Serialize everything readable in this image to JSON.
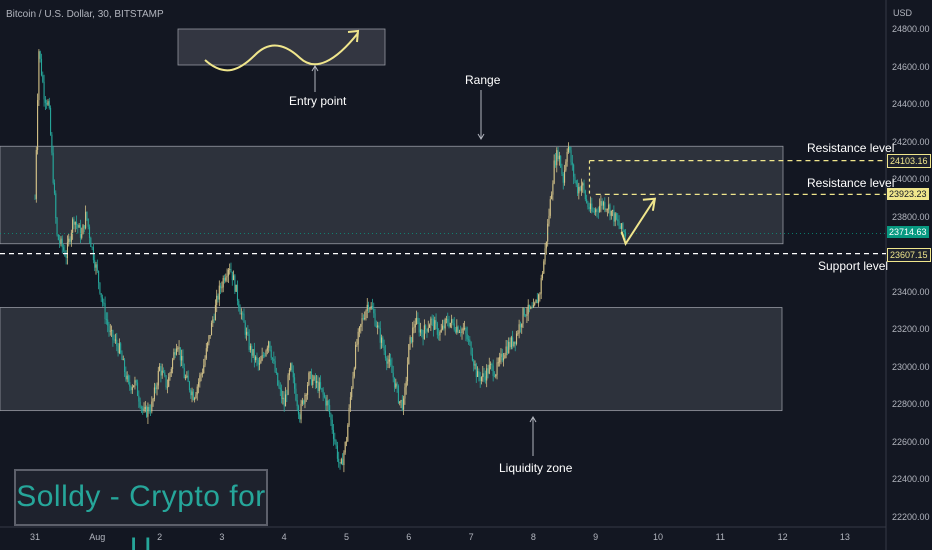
{
  "header": {
    "symbol": "Bitcoin / U.S. Dollar, 30, BITSTAMP"
  },
  "colors": {
    "bg": "#131722",
    "up": "#d1c087",
    "down": "#26a69a",
    "current": "#089981",
    "level": "#f0e68c"
  },
  "chart_data": {
    "type": "candlestick",
    "y_unit": "USD",
    "ylim": [
      22200,
      24800
    ],
    "y_ticks": [
      "24800.00",
      "24600.00",
      "24400.00",
      "24200.00",
      "24000.00",
      "23800.00",
      "23600.00",
      "23400.00",
      "23200.00",
      "23000.00",
      "22800.00",
      "22600.00",
      "22400.00",
      "22200.00"
    ],
    "x_ticks": [
      "31",
      "Aug",
      "2",
      "3",
      "4",
      "5",
      "6",
      "7",
      "8",
      "9",
      "10",
      "11",
      "12",
      "13"
    ],
    "series_points": [
      [
        0.0,
        23900
      ],
      [
        0.06,
        24700
      ],
      [
        0.15,
        24450
      ],
      [
        0.22,
        24400
      ],
      [
        0.35,
        23700
      ],
      [
        0.5,
        23600
      ],
      [
        0.62,
        23800
      ],
      [
        0.75,
        23700
      ],
      [
        0.82,
        23820
      ],
      [
        0.9,
        23660
      ],
      [
        1.0,
        23500
      ],
      [
        1.1,
        23320
      ],
      [
        1.2,
        23180
      ],
      [
        1.35,
        23100
      ],
      [
        1.5,
        22900
      ],
      [
        1.6,
        22920
      ],
      [
        1.75,
        22750
      ],
      [
        1.88,
        22800
      ],
      [
        2.0,
        23000
      ],
      [
        2.12,
        22900
      ],
      [
        2.28,
        23150
      ],
      [
        2.4,
        22950
      ],
      [
        2.55,
        22850
      ],
      [
        2.7,
        23000
      ],
      [
        2.85,
        23250
      ],
      [
        2.95,
        23400
      ],
      [
        3.05,
        23500
      ],
      [
        3.12,
        23550
      ],
      [
        3.2,
        23450
      ],
      [
        3.3,
        23300
      ],
      [
        3.45,
        23100
      ],
      [
        3.6,
        23000
      ],
      [
        3.75,
        23150
      ],
      [
        3.9,
        22900
      ],
      [
        4.0,
        22800
      ],
      [
        4.1,
        23000
      ],
      [
        4.25,
        22750
      ],
      [
        4.4,
        22950
      ],
      [
        4.55,
        22900
      ],
      [
        4.7,
        22800
      ],
      [
        4.82,
        22600
      ],
      [
        4.9,
        22450
      ],
      [
        5.0,
        22620
      ],
      [
        5.08,
        22900
      ],
      [
        5.15,
        23100
      ],
      [
        5.25,
        23250
      ],
      [
        5.35,
        23350
      ],
      [
        5.42,
        23300
      ],
      [
        5.55,
        23150
      ],
      [
        5.65,
        23050
      ],
      [
        5.75,
        22950
      ],
      [
        5.85,
        22820
      ],
      [
        5.92,
        22800
      ],
      [
        6.0,
        23100
      ],
      [
        6.1,
        23250
      ],
      [
        6.22,
        23180
      ],
      [
        6.35,
        23250
      ],
      [
        6.5,
        23180
      ],
      [
        6.62,
        23250
      ],
      [
        6.75,
        23220
      ],
      [
        6.88,
        23200
      ],
      [
        7.0,
        23100
      ],
      [
        7.1,
        22950
      ],
      [
        7.2,
        22950
      ],
      [
        7.3,
        23000
      ],
      [
        7.4,
        22980
      ],
      [
        7.55,
        23100
      ],
      [
        7.7,
        23150
      ],
      [
        7.85,
        23300
      ],
      [
        8.0,
        23300
      ],
      [
        8.1,
        23400
      ],
      [
        8.18,
        23600
      ],
      [
        8.26,
        23850
      ],
      [
        8.34,
        24100
      ],
      [
        8.4,
        24150
      ],
      [
        8.48,
        24000
      ],
      [
        8.55,
        24200
      ],
      [
        8.63,
        24050
      ],
      [
        8.7,
        23950
      ],
      [
        8.78,
        23980
      ],
      [
        8.85,
        23880
      ],
      [
        8.95,
        23820
      ],
      [
        9.02,
        23850
      ],
      [
        9.1,
        23880
      ],
      [
        9.2,
        23860
      ],
      [
        9.3,
        23800
      ],
      [
        9.4,
        23740
      ],
      [
        9.48,
        23715
      ]
    ],
    "levels": [
      {
        "label": "Resistance level",
        "price": 24103.16,
        "price_label": "24103.16"
      },
      {
        "label": "Resistance level",
        "price": 23923.23,
        "price_label": "23923.23"
      },
      {
        "label": "Support level",
        "price": 23607.15,
        "price_label": "23607.15"
      }
    ],
    "current_price": {
      "price": 23714.63,
      "price_label": "23714.63"
    },
    "zones": [
      {
        "label": "Range",
        "price_top": 24180,
        "price_bottom": 23660
      },
      {
        "label": "Liquidity zone",
        "price_top": 23320,
        "price_bottom": 22770
      }
    ],
    "annotations": [
      {
        "label": "Entry point"
      },
      {
        "label": "Range"
      },
      {
        "label": "Liquidity zone"
      }
    ],
    "projection": [
      [
        9.48,
        23660
      ],
      [
        9.95,
        23900
      ]
    ]
  },
  "watermark": {
    "text": "Solldy - Crypto for U"
  }
}
